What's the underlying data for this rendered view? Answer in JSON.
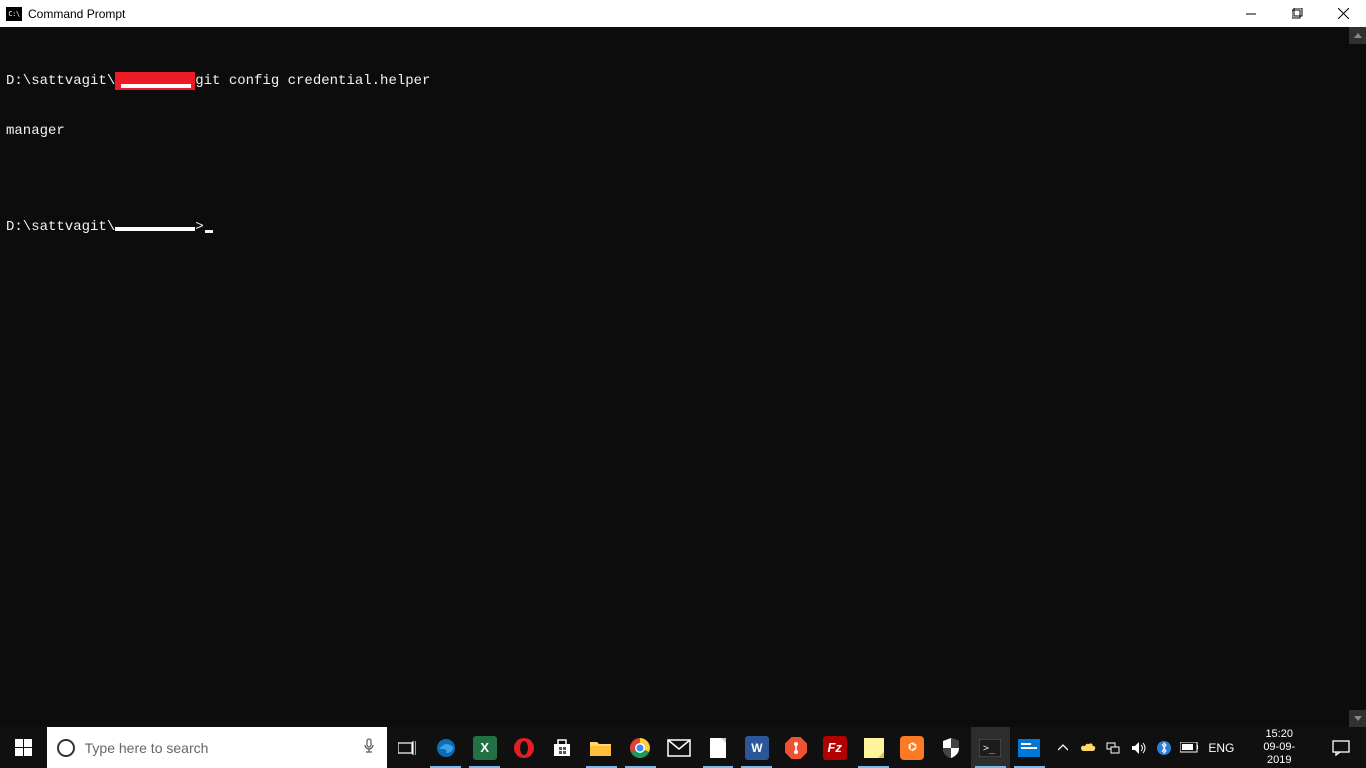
{
  "window": {
    "title": "Command Prompt",
    "icon_text": "C:\\"
  },
  "terminal": {
    "line1_pre": "D:\\sattvagit\\",
    "line1_post": "git config credential.helper",
    "line2": "manager",
    "line3_pre": "D:\\sattvagit\\",
    "line3_post": ">"
  },
  "taskbar": {
    "search_placeholder": "Type here to search",
    "lang": "ENG",
    "time": "15:20",
    "date": "09-09-2019"
  }
}
